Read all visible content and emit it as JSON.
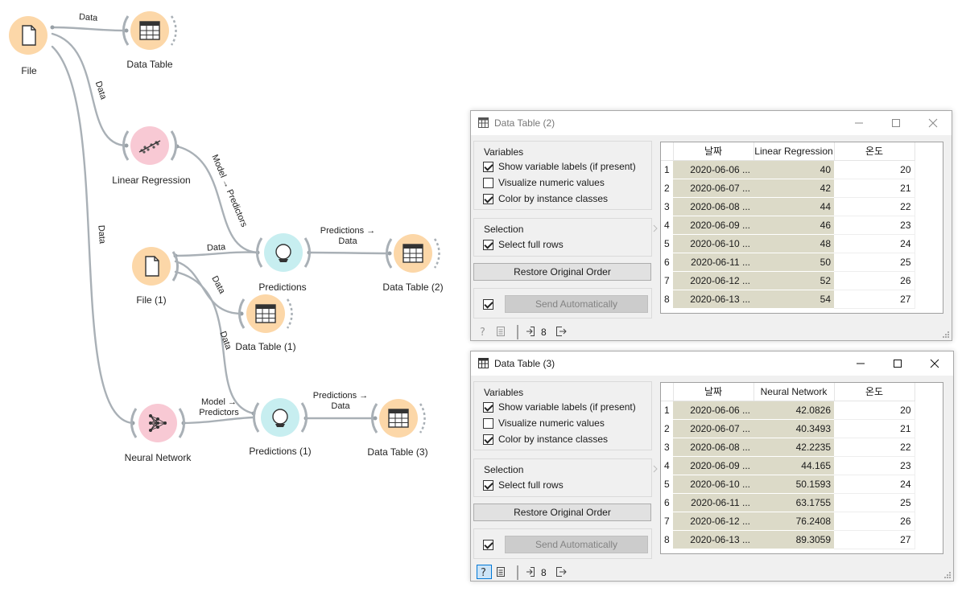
{
  "canvas": {
    "nodes": {
      "file": {
        "label": "File"
      },
      "data_table": {
        "label": "Data Table"
      },
      "linear_regression": {
        "label": "Linear Regression"
      },
      "file1": {
        "label": "File (1)"
      },
      "predictions": {
        "label": "Predictions"
      },
      "data_table2": {
        "label": "Data Table (2)"
      },
      "data_table1": {
        "label": "Data Table (1)"
      },
      "neural_network": {
        "label": "Neural Network"
      },
      "predictions1": {
        "label": "Predictions (1)"
      },
      "data_table3": {
        "label": "Data Table (3)"
      }
    },
    "links": {
      "file_to_table": "Data",
      "file_to_lr": "Data",
      "file_to_nn": "Data",
      "lr_to_pred": "Model → Predictors",
      "file1_to_pred": "Data",
      "file1_to_table1": "Data",
      "file1_to_pred1": "Data",
      "nn_to_pred1_line1": "Model →",
      "nn_to_pred1_line2": "Predictors",
      "pred_to_table2_line1": "Predictions →",
      "pred_to_table2_line2": "Data",
      "pred1_to_table3_line1": "Predictions →",
      "pred1_to_table3_line2": "Data"
    },
    "colors": {
      "data_widget": "#fcd7a8",
      "model_widget": "#f8c9d4",
      "eval_widget": "#c7eef0",
      "link": "#a9b0b6"
    }
  },
  "windows": [
    {
      "title": "Data Table (2)",
      "variables_title": "Variables",
      "show_labels": "Show variable labels (if present)",
      "visualize_numeric": "Visualize numeric values",
      "color_by_class": "Color by instance classes",
      "selection_title": "Selection",
      "select_full_rows": "Select full rows",
      "restore_label": "Restore Original Order",
      "send_label": "Send Automatically",
      "status_count": "8",
      "table": {
        "headers": [
          "날짜",
          "Linear Regression",
          "온도"
        ],
        "rows": [
          {
            "n": "1",
            "date": "2020-06-06 ...",
            "pred": "40",
            "temp": "20"
          },
          {
            "n": "2",
            "date": "2020-06-07 ...",
            "pred": "42",
            "temp": "21"
          },
          {
            "n": "3",
            "date": "2020-06-08 ...",
            "pred": "44",
            "temp": "22"
          },
          {
            "n": "4",
            "date": "2020-06-09 ...",
            "pred": "46",
            "temp": "23"
          },
          {
            "n": "5",
            "date": "2020-06-10 ...",
            "pred": "48",
            "temp": "24"
          },
          {
            "n": "6",
            "date": "2020-06-11 ...",
            "pred": "50",
            "temp": "25"
          },
          {
            "n": "7",
            "date": "2020-06-12 ...",
            "pred": "52",
            "temp": "26"
          },
          {
            "n": "8",
            "date": "2020-06-13 ...",
            "pred": "54",
            "temp": "27"
          }
        ]
      }
    },
    {
      "title": "Data Table (3)",
      "variables_title": "Variables",
      "show_labels": "Show variable labels (if present)",
      "visualize_numeric": "Visualize numeric values",
      "color_by_class": "Color by instance classes",
      "selection_title": "Selection",
      "select_full_rows": "Select full rows",
      "restore_label": "Restore Original Order",
      "send_label": "Send Automatically",
      "status_count": "8",
      "table": {
        "headers": [
          "날짜",
          "Neural Network",
          "온도"
        ],
        "rows": [
          {
            "n": "1",
            "date": "2020-06-06 ...",
            "pred": "42.0826",
            "temp": "20"
          },
          {
            "n": "2",
            "date": "2020-06-07 ...",
            "pred": "40.3493",
            "temp": "21"
          },
          {
            "n": "3",
            "date": "2020-06-08 ...",
            "pred": "42.2235",
            "temp": "22"
          },
          {
            "n": "4",
            "date": "2020-06-09 ...",
            "pred": "44.165",
            "temp": "23"
          },
          {
            "n": "5",
            "date": "2020-06-10 ...",
            "pred": "50.1593",
            "temp": "24"
          },
          {
            "n": "6",
            "date": "2020-06-11 ...",
            "pred": "63.1755",
            "temp": "25"
          },
          {
            "n": "7",
            "date": "2020-06-12 ...",
            "pred": "76.2408",
            "temp": "26"
          },
          {
            "n": "8",
            "date": "2020-06-13 ...",
            "pred": "89.3059",
            "temp": "27"
          }
        ]
      }
    }
  ]
}
